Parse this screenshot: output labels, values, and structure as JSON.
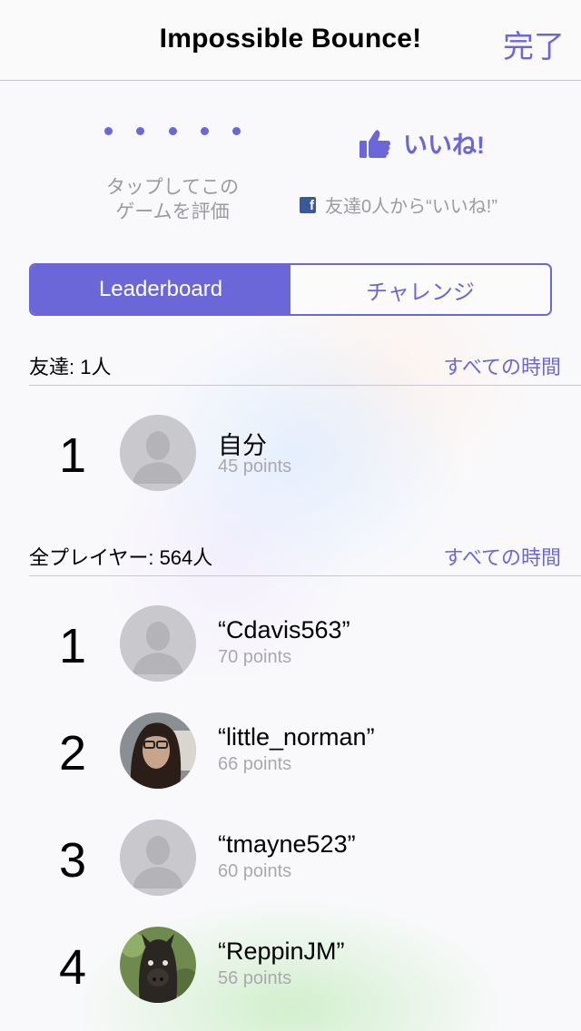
{
  "navbar": {
    "title": "Impossible Bounce!",
    "done_label": "完了"
  },
  "rating": {
    "dot_count": 5,
    "text_line1": "タップしてこの",
    "text_line2": "ゲームを評価"
  },
  "like": {
    "label": "いいね!",
    "fb_text": "友達0人から“いいね!”",
    "fb_icon": "f"
  },
  "segment": {
    "active_label": "Leaderboard",
    "inactive_label": "チャレンジ"
  },
  "friends_section": {
    "title": "友達: 1人",
    "filter": "すべての時間",
    "entries": [
      {
        "rank": "1",
        "name": "自分",
        "points": "45 points",
        "avatar": "default-silhouette"
      }
    ]
  },
  "all_section": {
    "title": "全プレイヤー: 564人",
    "filter": "すべての時間",
    "entries": [
      {
        "rank": "1",
        "name": "“Cdavis563”",
        "points": "70 points",
        "avatar": "default-silhouette"
      },
      {
        "rank": "2",
        "name": "“little_norman”",
        "points": "66 points",
        "avatar": "photo-person"
      },
      {
        "rank": "3",
        "name": "“tmayne523”",
        "points": "60 points",
        "avatar": "default-silhouette"
      },
      {
        "rank": "4",
        "name": "“ReppinJM”",
        "points": "56 points",
        "avatar": "photo-alpaca"
      }
    ]
  },
  "colors": {
    "accent": "#6b67d8",
    "secondary_text": "#9b9ba0",
    "facebook": "#3b5998"
  }
}
